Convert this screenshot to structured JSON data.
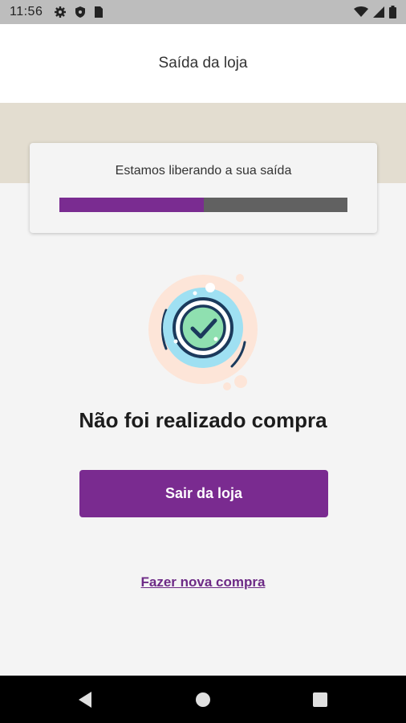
{
  "status_bar": {
    "time": "11:56",
    "left_icons": [
      "gear-icon",
      "shield-icon",
      "sim-card-icon"
    ],
    "right_icons": [
      "wifi-icon",
      "signal-icon",
      "battery-icon"
    ]
  },
  "header": {
    "title": "Saída da loja"
  },
  "progress": {
    "message": "Estamos liberando a sua saída",
    "fraction": 0.5,
    "fill_color": "#7a2c91",
    "track_color": "#616161"
  },
  "illustration": {
    "icon": "check-circle-icon"
  },
  "result": {
    "title": "Não foi realizado compra"
  },
  "actions": {
    "primary_label": "Sair da loja",
    "secondary_label": "Fazer nova compra"
  },
  "colors": {
    "accent": "#7a2b90",
    "band": "#e3ddd0",
    "background": "#f4f4f4"
  },
  "nav_bar": {
    "buttons": [
      "back-icon",
      "home-icon",
      "recents-icon"
    ]
  }
}
